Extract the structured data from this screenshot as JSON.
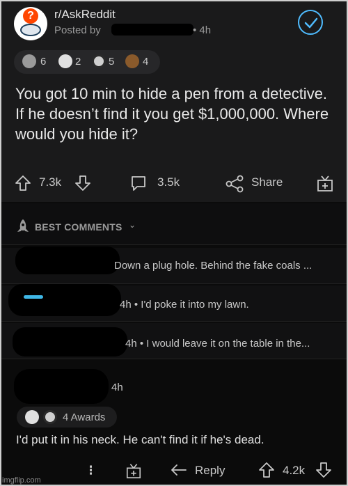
{
  "post": {
    "subreddit": "r/AskReddit",
    "posted_by": "Posted by",
    "time": "• 4h",
    "awards": [
      {
        "icon": "fist-award-icon",
        "count": "6",
        "color": "#cfcfcf"
      },
      {
        "icon": "cat-award-icon",
        "count": "2",
        "color": "#cfcfcf"
      },
      {
        "icon": "silver-award-icon",
        "count": "5",
        "color": "#cfcfcf"
      },
      {
        "icon": "monkey-award-icon",
        "count": "4",
        "color": "#8a5a2b"
      }
    ],
    "title": "You got 10 min to hide a pen from a detective. If he doesn’t find it you get $1,000,000. Where would you hide it?",
    "upvotes": "7.3k",
    "comments": "3.5k",
    "share_label": "Share"
  },
  "sort": {
    "label": "BEST COMMENTS"
  },
  "comments_collapsed": [
    {
      "text": "Down a plug hole. Behind the fake coals ..."
    },
    {
      "text": "4h • I'd poke it into my lawn."
    },
    {
      "text": "4h • I would leave it on the table in the..."
    }
  ],
  "expanded_comment": {
    "time": "4h",
    "awards_label": "4 Awards",
    "body": "I'd put it in his neck. He can't find it if he's dead.",
    "reply_label": "Reply",
    "score": "4.2k"
  },
  "watermark": "imgflip.com",
  "colors": {
    "accent": "#4fbcff",
    "background": "#0b0b0b",
    "card": "#1a1a1b"
  }
}
